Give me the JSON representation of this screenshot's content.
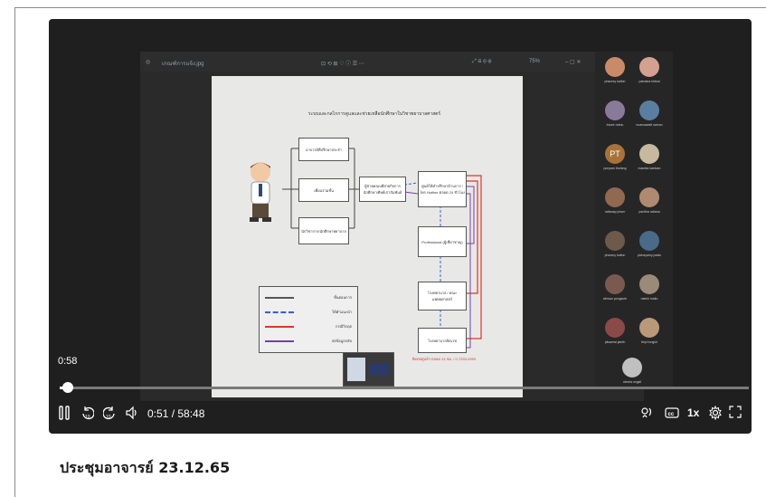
{
  "player": {
    "meet_window": {
      "file_name": "เกณฑ์การแจ้ง.jpg",
      "zoom_level": "75%"
    },
    "slide": {
      "title": "ระบบและกลไกการดูแลและช่วยเหลือนักศึกษาในวิชาพยาบาลศาสตร์",
      "left_boxes": [
        "อาจารย์ที่ปรึกษาประจำ",
        "เพื่อนร่วมชั้น",
        "นักวิชาการ/นักศึกษาพยาบาล"
      ],
      "middle_box": "ผู้ช่วยคณบดีฝ่ายกิจการนักศึกษา/ศิษย์เก่าสัมพันธ์",
      "right_boxes": [
        "ศูนย์ให้คำปรึกษาด้านการ / โทร Hotline ตลอด 24 ชั่วโมง",
        "Professional (ผู้เชี่ยวชาญ)",
        "โรงพยาบาล / คณะแพทยศาสตร์",
        "โรงพยาบาลจิตเวช"
      ],
      "legend": [
        {
          "label": "ขั้นตอนการ",
          "color": "#555555",
          "style": "solid"
        },
        {
          "label": "ให้คำแนะนำ",
          "color": "#3b5bdb",
          "style": "dashed"
        },
        {
          "label": "กรณีวิกฤต",
          "color": "#d9382b",
          "style": "solid"
        },
        {
          "label": "ส่งข้อมูลกลับ",
          "color": "#7b3fa6",
          "style": "solid"
        }
      ],
      "red_note": "ติดต่อศูนย์ฯ ตลอด 24 ชม. / 0-7333-9999"
    },
    "participants": [
      {
        "name": "phaorey kaifon",
        "initials": "",
        "color": "#c98a6a"
      },
      {
        "name": "pandara bidsai",
        "initials": "",
        "color": "#d4a090"
      },
      {
        "name": "bourir notnu",
        "initials": "",
        "color": "#8a7a9a"
      },
      {
        "name": "nuansawati samon",
        "initials": "",
        "color": "#5a7ea0"
      },
      {
        "name": "punyam thofang",
        "initials": "PT",
        "color": "#a8723a"
      },
      {
        "name": "maneta kaekam",
        "initials": "",
        "color": "#c9b8a0"
      },
      {
        "name": "rattanap phom",
        "initials": "",
        "color": "#8f6a50"
      },
      {
        "name": "panitha rattana",
        "initials": "",
        "color": "#b08a70"
      },
      {
        "name": "phaomy kaifon",
        "initials": "",
        "color": "#6d5a4a"
      },
      {
        "name": "pichayamy pastu",
        "initials": "",
        "color": "#4a6a8a"
      },
      {
        "name": "siriwan pongsute",
        "initials": "",
        "color": "#7a5a50"
      },
      {
        "name": "natchi maito",
        "initials": "",
        "color": "#9a8a7a"
      },
      {
        "name": "pitsamai jamth",
        "initials": "",
        "color": "#8a4a4a"
      },
      {
        "name": "thipi tonglol",
        "initials": "",
        "color": "#b89a7a"
      },
      {
        "name": "ciesha ungsil",
        "initials": "",
        "color": "#c0c0c0"
      }
    ],
    "hover_time": "0:58",
    "timecode": "0:51 / 58:48",
    "progress_fraction": 0.015,
    "speed_label": "1x",
    "controls": {
      "play_pause": "play-pause",
      "rewind": "rewind-10",
      "forward": "forward-10",
      "volume": "volume",
      "captions_label": "CC"
    }
  },
  "caption": {
    "title": "ประชุมอาจารย์ 23.12.65"
  }
}
